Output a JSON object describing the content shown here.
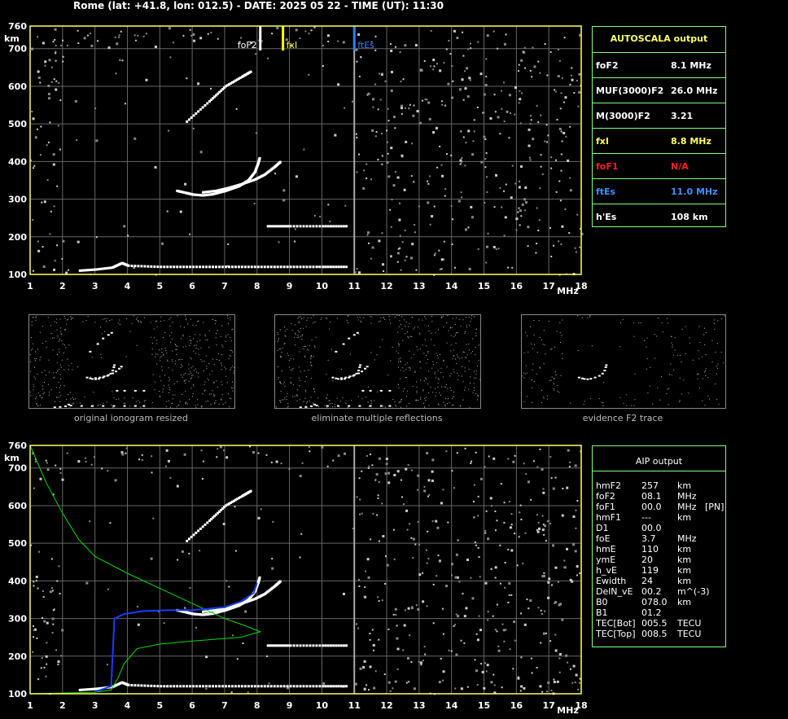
{
  "header": "Rome (lat: +41.8, lon: 012.5) - DATE: 2025 05 22 - TIME (UT): 11:30",
  "colors": {
    "axis": "#ffff66",
    "grid": "#666666",
    "panel_border": "#7fff7f",
    "fof2_marker": "#ffffff",
    "fxi_marker": "#ffff00",
    "ftes_marker": "#2f7fff",
    "profile": "#00dd00",
    "fitted": "#1a3cff",
    "fof1_na": "#ff2020"
  },
  "ionogram": {
    "km_label": "km",
    "mhz_label": "MHz",
    "y_ticks": [
      "760",
      "700",
      "600",
      "500",
      "400",
      "300",
      "200",
      "100"
    ],
    "x_ticks": [
      "1",
      "2",
      "3",
      "4",
      "5",
      "6",
      "7",
      "8",
      "9",
      "10",
      "11",
      "12",
      "13",
      "14",
      "15",
      "16",
      "17",
      "18"
    ],
    "markers": [
      {
        "label": "foF2",
        "freq": 8.1,
        "color": "#ffffff"
      },
      {
        "label": "fxI",
        "freq": 8.8,
        "color": "#ffff00"
      },
      {
        "label": "ftEs",
        "freq": 11.0,
        "color": "#2f7fff"
      }
    ]
  },
  "chart_data": {
    "type": "scatter",
    "xlabel": "MHz",
    "ylabel": "km",
    "xlim": [
      1,
      18
    ],
    "ylim": [
      100,
      760
    ],
    "series": [
      {
        "id": "o-trace",
        "values": [
          [
            5.5,
            322
          ],
          [
            5.8,
            316
          ],
          [
            6.0,
            312
          ],
          [
            6.3,
            310
          ],
          [
            6.6,
            313
          ],
          [
            7.0,
            322
          ],
          [
            7.4,
            334
          ],
          [
            7.7,
            350
          ],
          [
            7.9,
            372
          ],
          [
            8.0,
            395
          ],
          [
            8.05,
            410
          ]
        ]
      },
      {
        "id": "x-trace",
        "values": [
          [
            6.3,
            318
          ],
          [
            6.7,
            322
          ],
          [
            7.1,
            330
          ],
          [
            7.5,
            340
          ],
          [
            7.9,
            352
          ],
          [
            8.2,
            365
          ],
          [
            8.5,
            385
          ],
          [
            8.7,
            400
          ]
        ]
      },
      {
        "id": "es-trace",
        "values": [
          [
            2.5,
            110
          ],
          [
            3.0,
            113
          ],
          [
            3.5,
            118
          ],
          [
            3.8,
            130
          ],
          [
            4.0,
            123
          ],
          [
            5,
            120
          ],
          [
            6,
            120
          ],
          [
            7,
            120
          ],
          [
            8,
            120
          ],
          [
            9,
            120
          ],
          [
            10,
            120
          ],
          [
            10.8,
            120
          ]
        ]
      },
      {
        "id": "second-hop",
        "values": [
          [
            8.3,
            228
          ],
          [
            9,
            228
          ],
          [
            10,
            228
          ],
          [
            10.8,
            228
          ]
        ]
      },
      {
        "id": "upper-hop",
        "values": [
          [
            5.8,
            506
          ],
          [
            6.5,
            560
          ],
          [
            7.0,
            600
          ],
          [
            7.5,
            625
          ],
          [
            7.8,
            640
          ]
        ]
      }
    ],
    "profile": [
      [
        1,
        760
      ],
      [
        1.5,
        660
      ],
      [
        2,
        580
      ],
      [
        2.5,
        510
      ],
      [
        3,
        465
      ],
      [
        4,
        420
      ],
      [
        5,
        380
      ],
      [
        6,
        340
      ],
      [
        7,
        300
      ],
      [
        7.6,
        282
      ],
      [
        8.1,
        265
      ],
      [
        7.5,
        250
      ],
      [
        6,
        240
      ],
      [
        5,
        232
      ],
      [
        4.3,
        220
      ],
      [
        3.9,
        180
      ],
      [
        3.7,
        140
      ],
      [
        3.5,
        110
      ],
      [
        3,
        104
      ],
      [
        2,
        102
      ],
      [
        1,
        100
      ]
    ],
    "fitted": [
      [
        3.0,
        105
      ],
      [
        3.5,
        120
      ],
      [
        3.6,
        300
      ],
      [
        3.9,
        312
      ],
      [
        4.5,
        320
      ],
      [
        5.3,
        322
      ],
      [
        6.0,
        322
      ],
      [
        7.0,
        330
      ],
      [
        7.5,
        345
      ],
      [
        7.9,
        368
      ],
      [
        8.0,
        395
      ]
    ]
  },
  "autoscala": {
    "title": "AUTOSCALA output",
    "rows": [
      {
        "label": "foF2",
        "value": "8.1  MHz",
        "color": "#ffffff"
      },
      {
        "label": "MUF(3000)F2",
        "value": "26.0 MHz",
        "color": "#ffffff"
      },
      {
        "label": "M(3000)F2",
        "value": "3.21",
        "color": "#ffffff"
      },
      {
        "label": "fxI",
        "value": "8.8  MHz",
        "color": "#ffff66"
      },
      {
        "label": "foF1",
        "value": "N/A",
        "color": "#ff2020"
      },
      {
        "label": "ftEs",
        "value": "11.0 MHz",
        "color": "#3f8fff"
      },
      {
        "label": "h'Es",
        "value": "108     km",
        "color": "#ffffff"
      }
    ]
  },
  "thumbnails": [
    {
      "caption": "original ionogram resized"
    },
    {
      "caption": "eliminate multiple reflections"
    },
    {
      "caption": "evidence F2 trace"
    }
  ],
  "aip": {
    "title": "AIP output",
    "rows": [
      [
        "hmF2",
        "257",
        "km",
        ""
      ],
      [
        "foF2",
        "08.1",
        "MHz",
        ""
      ],
      [
        "foF1",
        "00.0",
        "MHz",
        "[PN]"
      ],
      [
        "hmF1",
        "---",
        "km",
        ""
      ],
      [
        "D1",
        "00.0",
        "",
        ""
      ],
      [
        "foE",
        "3.7",
        "MHz",
        ""
      ],
      [
        "hmE",
        "110",
        "km",
        ""
      ],
      [
        "ymE",
        "20",
        "km",
        ""
      ],
      [
        "h_vE",
        "119",
        "km",
        ""
      ],
      [
        "Ewidth",
        "24",
        "km",
        ""
      ],
      [
        "DelN_vE",
        "00.2",
        "m^(-3)",
        ""
      ],
      [
        "B0",
        "078.0",
        "km",
        ""
      ],
      [
        "B1",
        "01.2",
        "",
        ""
      ],
      [
        "TEC[Bot]",
        "005.5",
        "TECU",
        ""
      ],
      [
        "TEC[Top]",
        "008.5",
        "TECU",
        ""
      ]
    ]
  }
}
